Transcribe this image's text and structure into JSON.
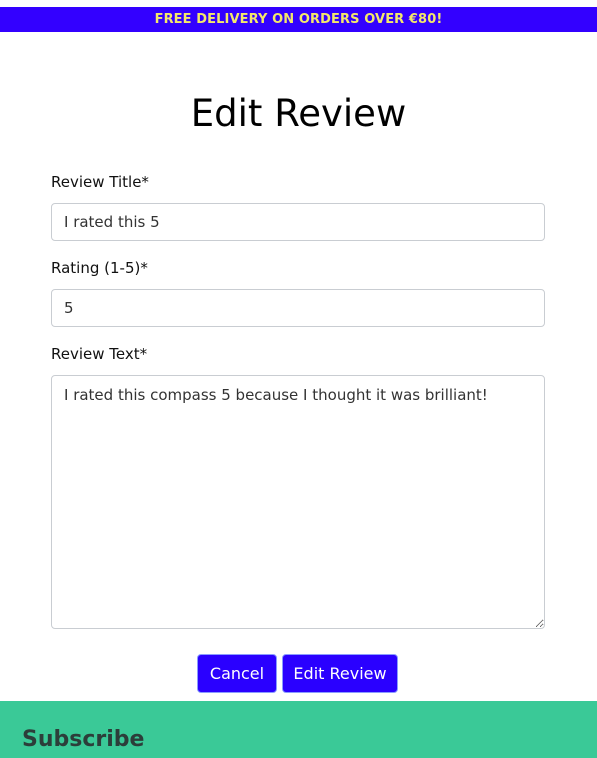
{
  "banner": {
    "text": "FREE DELIVERY ON ORDERS OVER €80!",
    "background": "#3300ff",
    "text_color": "#f4e86b"
  },
  "page": {
    "title": "Edit Review"
  },
  "form": {
    "review_title": {
      "label": "Review Title*",
      "value": "I rated this 5"
    },
    "rating": {
      "label": "Rating (1-5)*",
      "value": "5"
    },
    "review_text": {
      "label": "Review Text*",
      "value": "I rated this compass 5 because I thought it was brilliant!"
    },
    "cancel_label": "Cancel",
    "submit_label": "Edit Review",
    "button_color": "#2a00ff"
  },
  "footer": {
    "heading": "Subscribe",
    "background": "#3ac997"
  }
}
